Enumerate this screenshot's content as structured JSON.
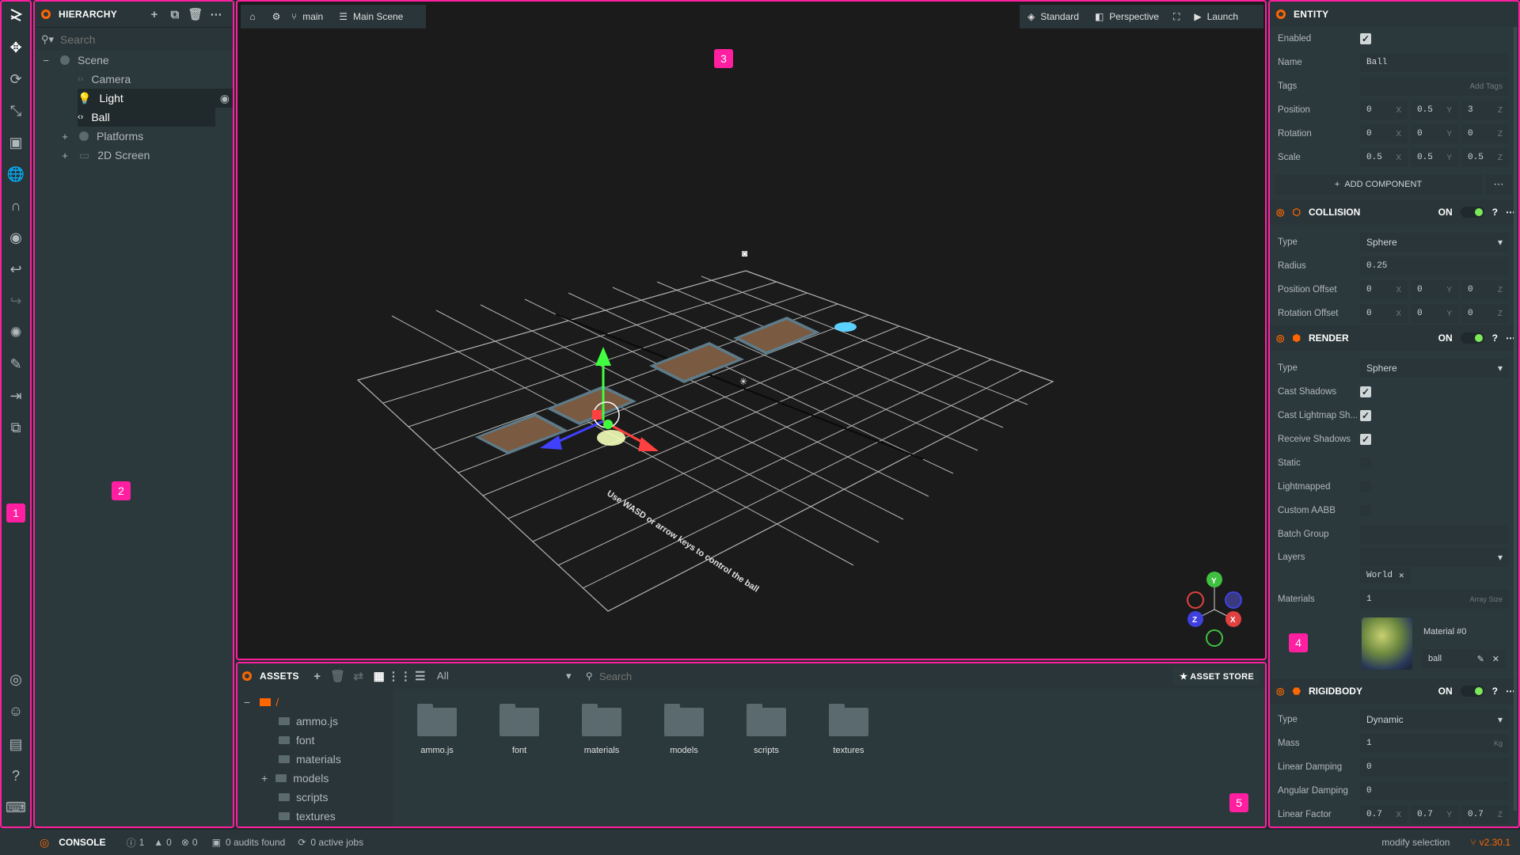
{
  "hierarchy": {
    "title": "HIERARCHY",
    "search_placeholder": "Search",
    "items": [
      {
        "label": "Scene"
      },
      {
        "label": "Camera"
      },
      {
        "label": "Light"
      },
      {
        "label": "Ball"
      },
      {
        "label": "Platforms"
      },
      {
        "label": "2D Screen"
      }
    ]
  },
  "viewport": {
    "branch": "main",
    "scene": "Main Scene",
    "render_mode": "Standard",
    "camera": "Perspective",
    "launch": "Launch",
    "hint_text": "Use WASD or arrow keys to control the ball",
    "gizmo_y": "Y",
    "gizmo_x": "X",
    "gizmo_z": "Z"
  },
  "inspector": {
    "title": "ENTITY",
    "enabled_label": "Enabled",
    "name_label": "Name",
    "name_value": "Ball",
    "tags_label": "Tags",
    "add_tags": "Add Tags",
    "position_label": "Position",
    "position": [
      "0",
      "0.5",
      "3"
    ],
    "rotation_label": "Rotation",
    "rotation": [
      "0",
      "0",
      "0"
    ],
    "scale_label": "Scale",
    "scale": [
      "0.5",
      "0.5",
      "0.5"
    ],
    "axes": [
      "X",
      "Y",
      "Z"
    ],
    "add_component": "ADD COMPONENT",
    "on_label": "ON",
    "collision": {
      "title": "COLLISION",
      "type_label": "Type",
      "type_value": "Sphere",
      "radius_label": "Radius",
      "radius_value": "0.25",
      "pos_offset_label": "Position Offset",
      "pos_offset": [
        "0",
        "0",
        "0"
      ],
      "rot_offset_label": "Rotation Offset",
      "rot_offset": [
        "0",
        "0",
        "0"
      ]
    },
    "render": {
      "title": "RENDER",
      "type_label": "Type",
      "type_value": "Sphere",
      "cast_shadows": "Cast Shadows",
      "cast_lightmap": "Cast Lightmap Sh...",
      "receive_shadows": "Receive Shadows",
      "static": "Static",
      "lightmapped": "Lightmapped",
      "custom_aabb": "Custom AABB",
      "batch_group": "Batch Group",
      "layers": "Layers",
      "layer_tag": "World",
      "materials_label": "Materials",
      "materials_count": "1",
      "array_size": "Array Size",
      "material_name": "Material #0",
      "material_asset": "ball"
    },
    "rigidbody": {
      "title": "RIGIDBODY",
      "type_label": "Type",
      "type_value": "Dynamic",
      "mass_label": "Mass",
      "mass_value": "1",
      "mass_unit": "Kg",
      "linear_damping_label": "Linear Damping",
      "linear_damping": "0",
      "angular_damping_label": "Angular Damping",
      "angular_damping": "0",
      "linear_factor_label": "Linear Factor",
      "linear_factor": [
        "0.7",
        "0.7",
        "0.7"
      ]
    }
  },
  "assets": {
    "title": "ASSETS",
    "filter": "All",
    "search_placeholder": "Search",
    "store": "ASSET STORE",
    "root": "/",
    "tree": [
      "ammo.js",
      "font",
      "materials",
      "models",
      "scripts",
      "textures"
    ],
    "folders": [
      "ammo.js",
      "font",
      "materials",
      "models",
      "scripts",
      "textures"
    ]
  },
  "status": {
    "console": "CONSOLE",
    "info_count": "1",
    "warn_count": "0",
    "error_count": "0",
    "audits": "0 audits found",
    "jobs": "0 active jobs",
    "selection": "modify selection",
    "version": "v2.30.1"
  },
  "annotations": [
    "1",
    "2",
    "3",
    "4",
    "5"
  ]
}
